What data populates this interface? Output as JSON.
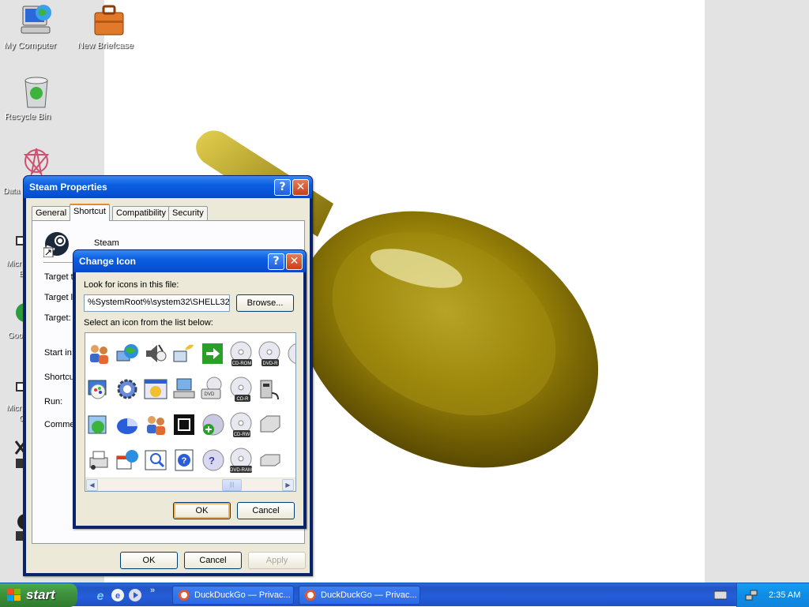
{
  "desktop": {
    "icons": [
      {
        "label": "My Computer"
      },
      {
        "label": "New Briefcase"
      },
      {
        "label": "Recycle Bin"
      }
    ],
    "partial_labels": [
      "Data",
      "Micr",
      "B",
      "Goo",
      "Micr",
      "C"
    ]
  },
  "steam_props": {
    "title": "Steam Properties",
    "help_btn": "?",
    "close_btn": "✕",
    "tabs": [
      "General",
      "Shortcut",
      "Compatibility",
      "Security"
    ],
    "active_tab": "Shortcut",
    "app_name": "Steam",
    "fields": {
      "target_type": "Target ty",
      "target_location": "Target lo",
      "target": "Target:",
      "start_in": "Start in:",
      "shortcut_key": "Shortcu",
      "run": "Run:",
      "comment": "Commen"
    },
    "buttons": {
      "ok": "OK",
      "cancel": "Cancel",
      "apply": "Apply"
    }
  },
  "change_icon": {
    "title": "Change Icon",
    "help_btn": "?",
    "close_btn": "✕",
    "look_label": "Look for icons in this file:",
    "file_path": "%SystemRoot%\\system32\\SHELL32",
    "browse": "Browse...",
    "select_label": "Select an icon from the list below:",
    "cd_labels": [
      "CD-ROM",
      "DVD-R",
      "DVD",
      "CD-R",
      "CD-RW",
      "DVD-RAM",
      "DVD"
    ],
    "buttons": {
      "ok": "OK",
      "cancel": "Cancel"
    }
  },
  "taskbar": {
    "start": "start",
    "chevron": "»",
    "tasks": [
      "DuckDuckGo — Privac...",
      "DuckDuckGo — Privac..."
    ],
    "clock": "2:35 AM"
  },
  "colors": {
    "title_blue": "#0a5ee0",
    "taskbar_blue": "#245edb",
    "start_green": "#3c8f3c",
    "dialog_bg": "#ece9d8",
    "wallpaper_gold": "#b8a210"
  }
}
